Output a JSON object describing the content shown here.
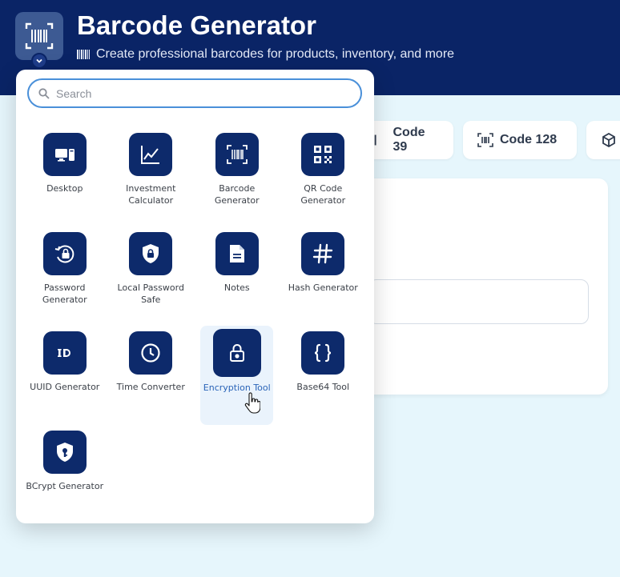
{
  "header": {
    "title": "Barcode Generator",
    "subtitle": "Create professional barcodes for products, inventory, and more",
    "app_icon": "barcode-scan-icon"
  },
  "tabs": [
    {
      "label": "Code 39",
      "icon": "barcode-icon"
    },
    {
      "label": "Code 128",
      "icon": "barcode-scan-icon"
    },
    {
      "label": "",
      "icon": "cube-icon"
    }
  ],
  "launcher": {
    "search_placeholder": "Search",
    "apps": [
      {
        "label": "Desktop",
        "icon": "desktop-icon"
      },
      {
        "label": "Investment Calculator",
        "icon": "chart-line-icon"
      },
      {
        "label": "Barcode Generator",
        "icon": "barcode-scan-icon"
      },
      {
        "label": "QR Code Generator",
        "icon": "qr-code-icon"
      },
      {
        "label": "Password Generator",
        "icon": "lock-rotate-icon"
      },
      {
        "label": "Local Password Safe",
        "icon": "shield-lock-icon"
      },
      {
        "label": "Notes",
        "icon": "note-icon"
      },
      {
        "label": "Hash Generator",
        "icon": "hash-icon"
      },
      {
        "label": "UUID Generator",
        "icon": "id-icon"
      },
      {
        "label": "Time Converter",
        "icon": "clock-icon"
      },
      {
        "label": "Encryption Tool",
        "icon": "padlock-icon"
      },
      {
        "label": "Base64 Tool",
        "icon": "braces-icon"
      },
      {
        "label": "BCrypt Generator",
        "icon": "shield-key-icon"
      }
    ]
  },
  "colors": {
    "header_bg": "#0a2466",
    "tile_bg": "#0d2a6b",
    "active_label": "#2a64b8",
    "search_border": "#4a90d9"
  }
}
